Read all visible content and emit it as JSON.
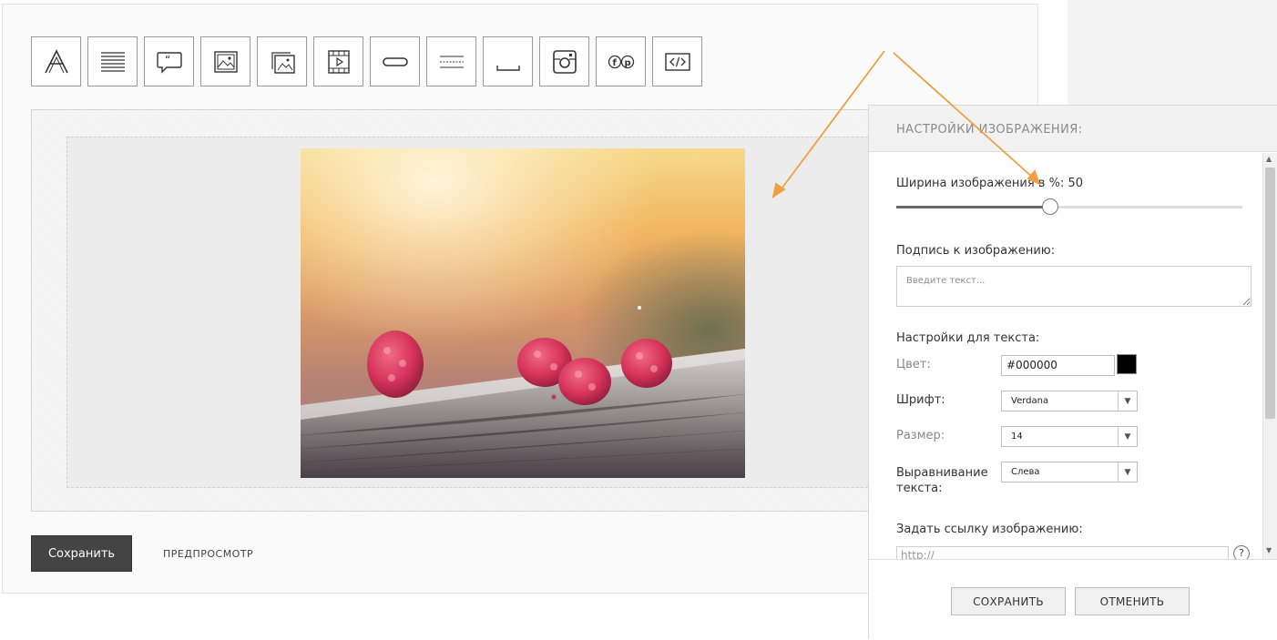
{
  "toolbar": {
    "tools": [
      {
        "icon": "text-icon"
      },
      {
        "icon": "paragraph-icon"
      },
      {
        "icon": "quote-icon"
      },
      {
        "icon": "image-icon"
      },
      {
        "icon": "gallery-icon"
      },
      {
        "icon": "video-icon"
      },
      {
        "icon": "button-icon"
      },
      {
        "icon": "divider-icon"
      },
      {
        "icon": "spacer-icon"
      },
      {
        "icon": "instagram-icon"
      },
      {
        "icon": "facebook-pinterest-icon"
      },
      {
        "icon": "code-icon"
      }
    ]
  },
  "editor": {
    "save_label": "Сохранить",
    "preview_label": "ПРЕДПРОСМОТР"
  },
  "panel": {
    "title": "НАСТРОЙКИ ИЗОБРАЖЕНИЯ:",
    "width_label": "Ширина изображения в %: 50",
    "width_percent": 50,
    "caption_label": "Подпись к изображению:",
    "caption_placeholder": "Введите текст...",
    "text_settings_label": "Настройки для текста:",
    "color_label": "Цвет:",
    "color_value": "#000000",
    "font_label": "Шрифт:",
    "font_value": "Verdana",
    "size_label": "Размер:",
    "size_value": "14",
    "align_label": "Выравнивание текста:",
    "align_value": "Слева",
    "link_label": "Задать ссылку изображению:",
    "link_placeholder": "http://",
    "help_symbol": "?",
    "save_label": "СОХРАНИТЬ",
    "cancel_label": "ОТМЕНИТЬ"
  },
  "colors": {
    "accent_arrow": "#f0a040",
    "dark_button": "#444444"
  }
}
